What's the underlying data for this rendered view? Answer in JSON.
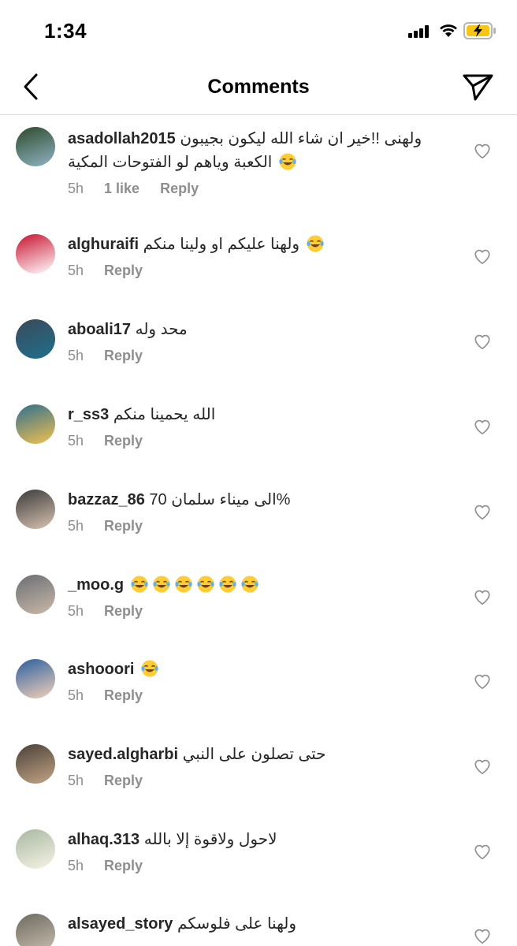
{
  "status_bar": {
    "time": "1:34",
    "battery_color": "#f5c518"
  },
  "header": {
    "title": "Comments",
    "back_icon": "chevron-left-icon",
    "send_icon": "paper-plane-icon"
  },
  "comments": [
    {
      "username": "asadollah2015",
      "text": "ولهنى !!خير ان شاء الله ليكون بجيبون الكعبة وياهم لو الفتوحات المكية",
      "emojis": 1,
      "time": "5h",
      "likes": "1 like",
      "reply": "Reply"
    },
    {
      "username": "alghuraifi",
      "text": "ولهنا عليكم او ولينا منكم",
      "emojis": 1,
      "time": "5h",
      "reply": "Reply"
    },
    {
      "username": "aboali17",
      "text": "محد وله",
      "emojis": 0,
      "time": "5h",
      "reply": "Reply"
    },
    {
      "username": "r_ss3",
      "text": "الله يحمينا منكم",
      "emojis": 0,
      "time": "5h",
      "reply": "Reply"
    },
    {
      "username": "bazzaz_86",
      "text": "الى ميناء سلمان 70%",
      "emojis": 0,
      "time": "5h",
      "reply": "Reply"
    },
    {
      "username": "_moo.g",
      "text": "",
      "emojis": 6,
      "time": "5h",
      "reply": "Reply"
    },
    {
      "username": "ashooori",
      "text": "",
      "emojis": 1,
      "time": "5h",
      "reply": "Reply"
    },
    {
      "username": "sayed.algharbi",
      "text": "حتى تصلون على النبي",
      "emojis": 0,
      "time": "5h",
      "reply": "Reply"
    },
    {
      "username": "alhaq.313",
      "text": "لاحول ولاقوة إلا بالله",
      "emojis": 0,
      "time": "5h",
      "reply": "Reply"
    },
    {
      "username": "alsayed_story",
      "text": "ولهنا على فلوسكم",
      "emojis": 0,
      "time": "",
      "reply": ""
    }
  ]
}
